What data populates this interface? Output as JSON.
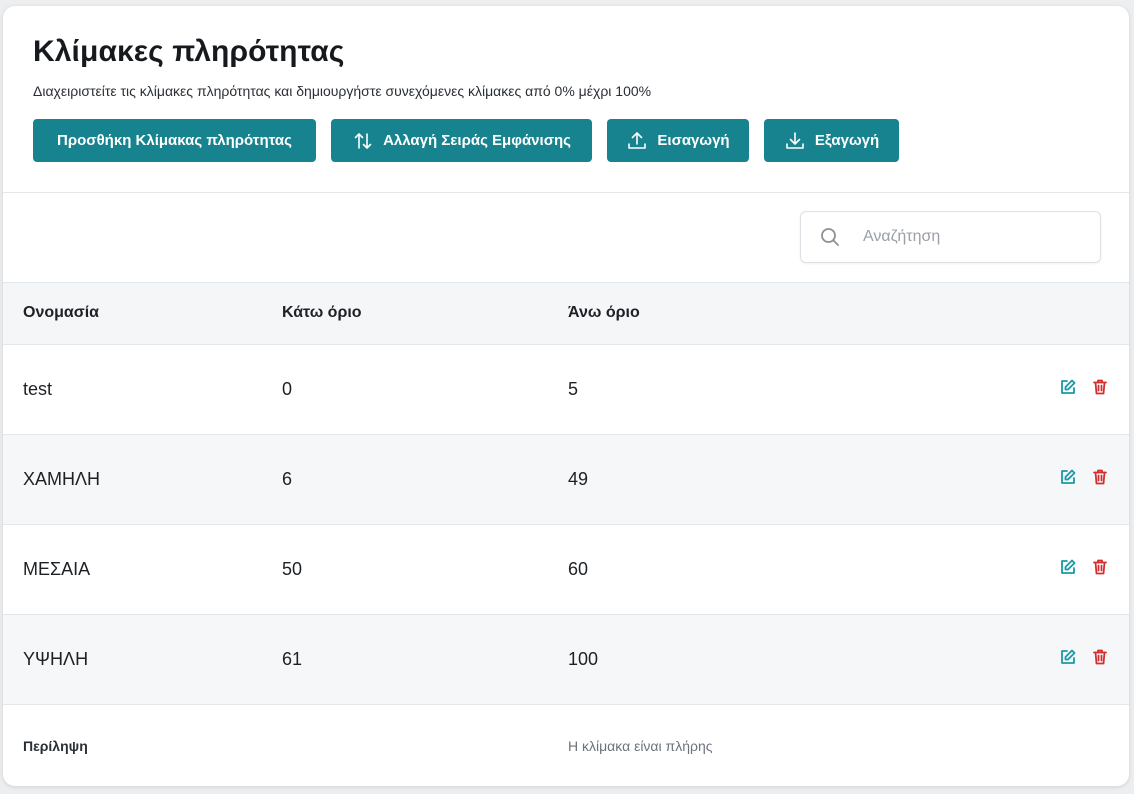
{
  "page": {
    "title": "Κλίμακες πληρότητας",
    "subtitle": "Διαχειριστείτε τις κλίμακες πληρότητας και δημιουργήστε συνεχόμενες κλίμακες από 0% μέχρι 100%"
  },
  "actions": {
    "add_label": "Προσθήκη Κλίμακας πληρότητας",
    "reorder_label": "Αλλαγή Σειράς Εμφάνισης",
    "import_label": "Εισαγωγή",
    "export_label": "Εξαγωγή"
  },
  "search": {
    "placeholder": "Αναζήτηση",
    "value": ""
  },
  "table": {
    "columns": [
      "Ονομασία",
      "Κάτω όριο",
      "Άνω όριο"
    ],
    "rows": [
      {
        "name": "test",
        "lower": "0",
        "upper": "5"
      },
      {
        "name": "ΧΑΜΗΛΗ",
        "lower": "6",
        "upper": "49"
      },
      {
        "name": "ΜΕΣΑΙΑ",
        "lower": "50",
        "upper": "60"
      },
      {
        "name": "ΥΨΗΛΗ",
        "lower": "61",
        "upper": "100"
      }
    ],
    "summary": {
      "label": "Περίληψη",
      "status": "Η κλίμακα είναι πλήρης"
    }
  },
  "colors": {
    "primary": "#17838f",
    "edit_icon": "#1a9aa6",
    "delete_icon": "#d32f2f"
  },
  "icons": {
    "reorder": "arrows-up-down-icon",
    "import": "upload-icon",
    "export": "download-icon",
    "search": "search-icon",
    "edit": "edit-icon",
    "delete": "trash-icon"
  }
}
